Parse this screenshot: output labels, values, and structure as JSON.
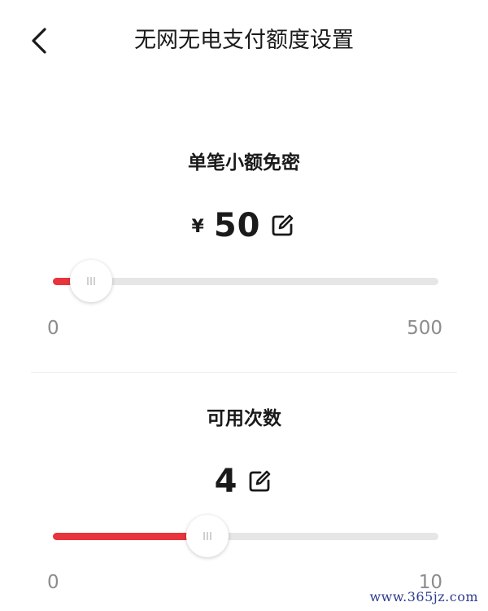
{
  "header": {
    "title": "无网无电支付额度设置",
    "back_icon": "chevron-left-icon"
  },
  "single_limit": {
    "title": "单笔小额免密",
    "currency": "¥",
    "value": "50",
    "min_label": "0",
    "max_label": "500",
    "min": 0,
    "max": 500,
    "current": 50
  },
  "usage_count": {
    "title": "可用次数",
    "value": "4",
    "min_label": "0",
    "max_label": "10",
    "min": 0,
    "max": 10,
    "current": 4
  },
  "colors": {
    "accent": "#e8343c",
    "track": "#e6e6e6",
    "muted_text": "#8c8c8c"
  },
  "watermark": "www.365jz.com"
}
